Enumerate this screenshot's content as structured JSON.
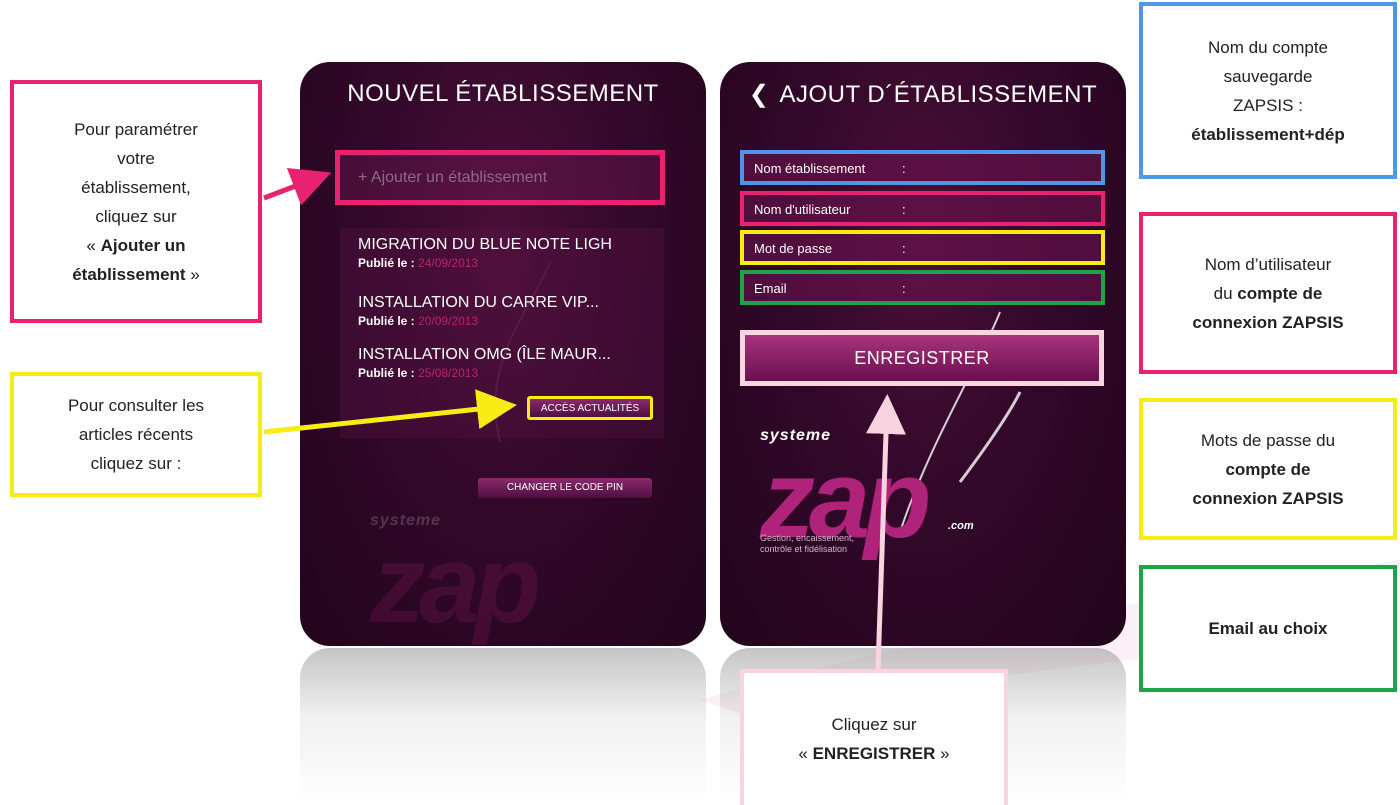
{
  "left_phone": {
    "title": "NOUVEL ÉTABLISSEMENT",
    "add_button_label": "+ Ajouter un établissement",
    "news": [
      {
        "title": "MIGRATION DU BLUE NOTE LIGH",
        "date_label": "Publié le :",
        "date": "24/09/2013"
      },
      {
        "title": "INSTALLATION DU CARRE VIP...",
        "date_label": "Publié le :",
        "date": "20/09/2013"
      },
      {
        "title": "INSTALLATION OMG (ÎLE MAUR...",
        "date_label": "Publié le :",
        "date": "25/08/2013"
      }
    ],
    "news_button": "ACCÈS ACTUALITÉS",
    "pin_button": "CHANGER LE CODE PIN"
  },
  "right_phone": {
    "back_icon": "chevron-left-icon",
    "title": "AJOUT D´ÉTABLISSEMENT",
    "fields": [
      {
        "label": "Nom  établissement",
        "colon": ":"
      },
      {
        "label": "Nom d'utilisateur",
        "colon": ":"
      },
      {
        "label": "Mot de passe",
        "colon": ":"
      },
      {
        "label": "Email",
        "colon": ":"
      }
    ],
    "save_button": "ENREGISTRER"
  },
  "logo": {
    "systeme": "systeme",
    "zap": "zap",
    "tagline_1": "Gestion, encaissement,",
    "tagline_2": "contrôle et fidélisation",
    "com": ".com"
  },
  "callouts": {
    "left_setup": {
      "line1": "Pour paramétrer",
      "line2": "votre",
      "line3": "établissement,",
      "line4": "cliquez sur",
      "line5_prefix": "« ",
      "line5_bold": "Ajouter un",
      "line6_bold": "établissement",
      "line6_suffix": " »"
    },
    "left_news": {
      "line1": "Pour consulter les",
      "line2": "articles récents",
      "line3": "cliquez sur :"
    },
    "right_account": {
      "line1": "Nom du compte",
      "line2": "sauvegarde",
      "line3": "ZAPSIS :",
      "line4_bold": "établissement+dép"
    },
    "right_user": {
      "line1": "Nom d’utilisateur",
      "line2_prefix": "du ",
      "line2_bold": "compte de",
      "line3_bold": "connexion ZAPSIS"
    },
    "right_password": {
      "line1": "Mots de passe du",
      "line2_bold": "compte de",
      "line3_bold": "connexion ZAPSIS"
    },
    "right_email": {
      "line1_bold": "Email au choix"
    },
    "bottom_save": {
      "line1": "Cliquez sur",
      "line2_prefix": "« ",
      "line2_bold": "ENREGISTRER",
      "line2_suffix": " »"
    }
  },
  "colors": {
    "pink": "#e8226e",
    "yellow": "#f7ec13",
    "blue": "#4f96e8",
    "green": "#1ea34a",
    "light_pink": "#fad3e0",
    "phone_bg": "#33082a",
    "date_color": "#b8246e"
  }
}
